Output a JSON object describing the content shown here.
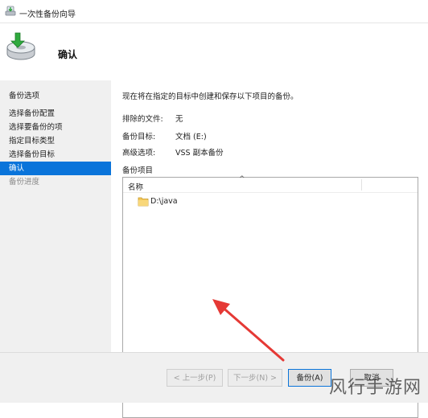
{
  "window": {
    "title": "一次性备份向导"
  },
  "header": {
    "title": "确认"
  },
  "sidebar": {
    "section_label": "备份选项",
    "items": [
      {
        "label": "选择备份配置",
        "state": "normal"
      },
      {
        "label": "选择要备份的项",
        "state": "normal"
      },
      {
        "label": "指定目标类型",
        "state": "normal"
      },
      {
        "label": "选择备份目标",
        "state": "normal"
      },
      {
        "label": "确认",
        "state": "active"
      },
      {
        "label": "备份进度",
        "state": "disabled"
      }
    ]
  },
  "main": {
    "intro": "现在将在指定的目标中创建和保存以下项目的备份。",
    "fields": [
      {
        "label": "排除的文件:",
        "value": "无"
      },
      {
        "label": "备份目标:",
        "value": "文档 (E:)"
      },
      {
        "label": "高级选项:",
        "value": "VSS 副本备份"
      }
    ],
    "items_label": "备份项目",
    "list": {
      "column_name": "名称",
      "sort_indicator": "^",
      "rows": [
        {
          "path": "D:\\java"
        }
      ]
    }
  },
  "buttons": {
    "prev": "< 上一步(P)",
    "next": "下一步(N) >",
    "backup": "备份(A)",
    "cancel": "取消"
  },
  "watermark": "风行手游网",
  "colors": {
    "accent": "#0a74da",
    "arrow": "#e53935",
    "sidebar_bg": "#f0f0f0"
  }
}
